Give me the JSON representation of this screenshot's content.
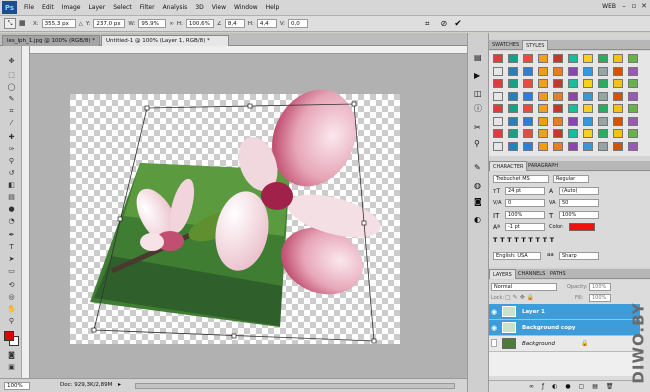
{
  "app": {
    "logo": "Ps",
    "workspace": "WEB"
  },
  "menus": [
    "File",
    "Edit",
    "Image",
    "Layer",
    "Select",
    "Filter",
    "Analysis",
    "3D",
    "View",
    "Window",
    "Help"
  ],
  "options": {
    "x": "355,3 px",
    "y": "237,0 px",
    "w": "95,9%",
    "h": "100,6%",
    "angle": "8,4",
    "hskew": "4,4",
    "vskew": "0,0",
    "x_label": "X:",
    "y_label": "Y:",
    "w_label": "W:",
    "h_label": "H:",
    "v_label": "V:"
  },
  "doc_tabs": [
    {
      "label": "les_lph_1.jpg @ 100% (RGB/8) *"
    },
    {
      "label": "Untitled-1 @ 100% (Layer 1, RGB/8) *"
    }
  ],
  "status": {
    "zoom": "100%",
    "doc": "Doc: 929,3K/2,89M"
  },
  "swatches_tabs": [
    "SWATCHES",
    "STYLES"
  ],
  "character_tabs": [
    "CHARACTER",
    "PARAGRAPH"
  ],
  "character": {
    "font": "Trebuchet MS",
    "style": "Regular",
    "size": "24 pt",
    "leading": "(Auto)",
    "kerning": "0",
    "tracking": "50",
    "vscale": "100%",
    "hscale": "100%",
    "baseline": "-1 pt",
    "color_label": "Color:",
    "language": "English: USA",
    "aa": "Sharp",
    "aa_icon": "aa"
  },
  "layers_tabs": [
    "LAYERS",
    "CHANNELS",
    "PATHS"
  ],
  "layers": {
    "blend": "Normal",
    "opacity_label": "Opacity:",
    "opacity": "100%",
    "lock_label": "Lock:",
    "fill_label": "Fill:",
    "fill": "100%",
    "items": [
      {
        "name": "Layer 1"
      },
      {
        "name": "Background copy"
      },
      {
        "name": "Background"
      }
    ]
  },
  "watermark": "DIWO.BY",
  "colors": {
    "selected": "#3d9ddb",
    "foreground": "#e00000",
    "text_color": "#ee1111"
  }
}
